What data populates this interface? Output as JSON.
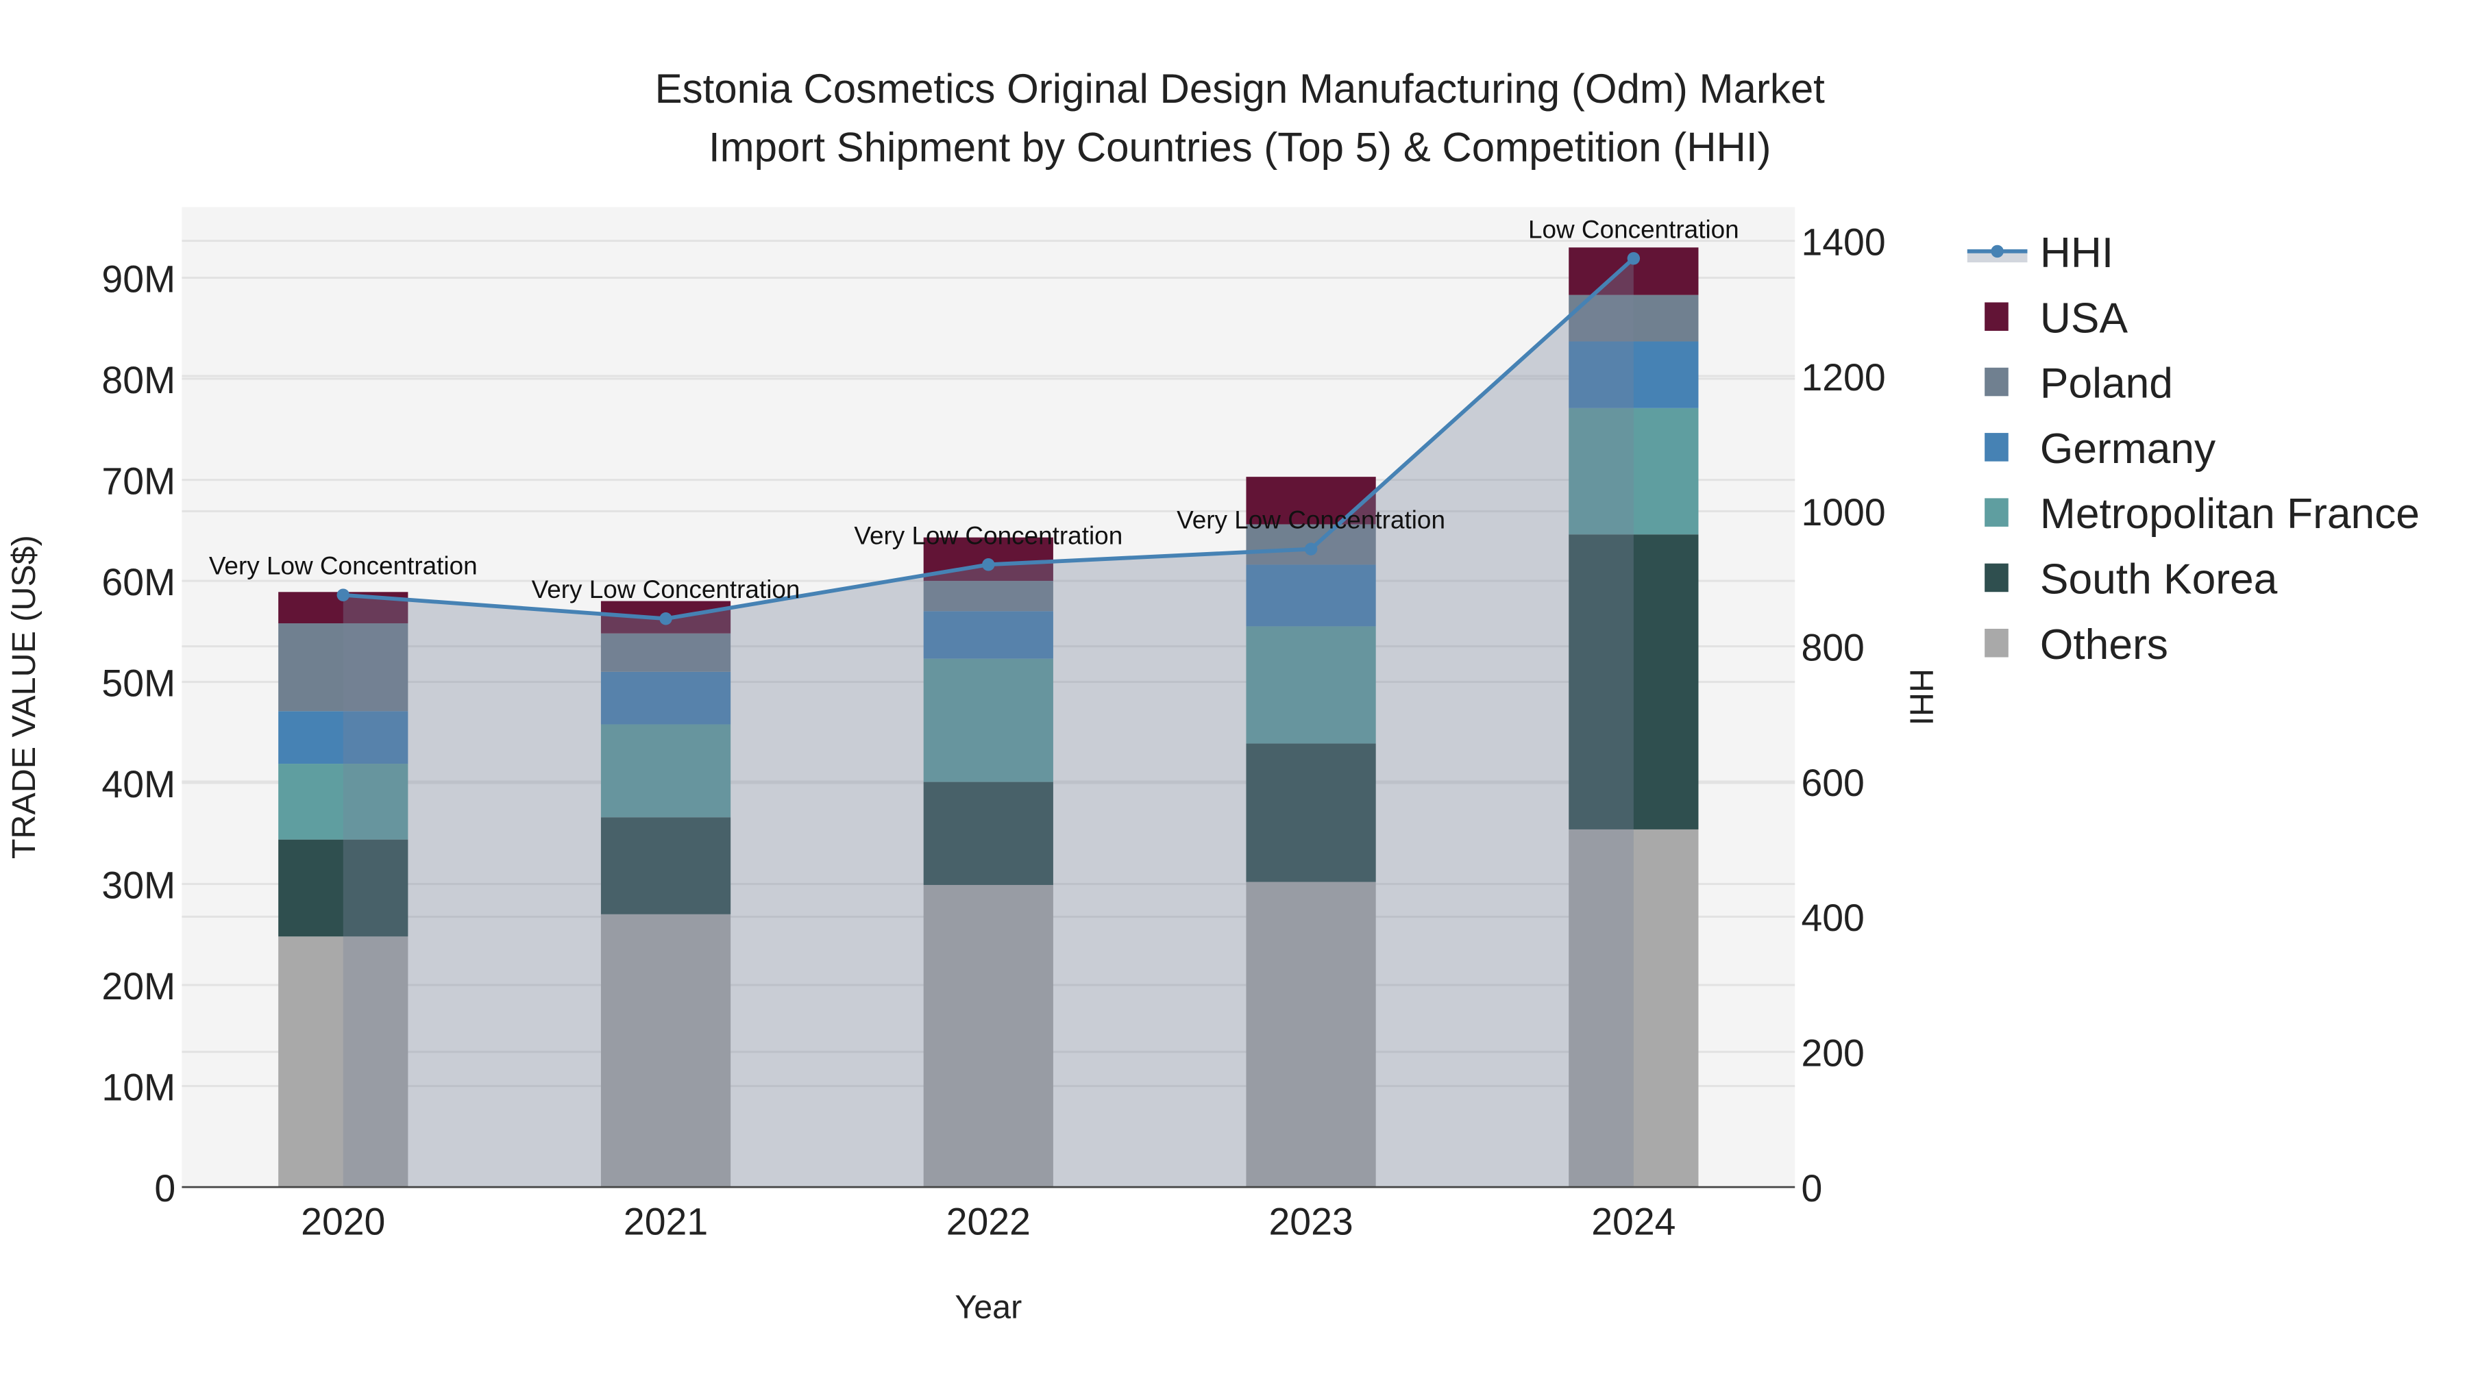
{
  "chart_data": {
    "type": "bar",
    "title_line1": "Estonia Cosmetics Original Design Manufacturing (Odm) Market",
    "title_line2": "Import Shipment by Countries (Top 5) & Competition (HHI)",
    "xlabel": "Year",
    "ylabel": "TRADE VALUE (US$)",
    "y2label": "HHI",
    "categories": [
      "2020",
      "2021",
      "2022",
      "2023",
      "2024"
    ],
    "ylim": [
      0,
      97000000
    ],
    "y2lim": [
      0,
      1450
    ],
    "yticks": [
      0,
      10000000,
      20000000,
      30000000,
      40000000,
      50000000,
      60000000,
      70000000,
      80000000,
      90000000
    ],
    "ytick_labels": [
      "0",
      "10M",
      "20M",
      "30M",
      "40M",
      "50M",
      "60M",
      "70M",
      "80M",
      "90M"
    ],
    "y2ticks": [
      0,
      200,
      400,
      600,
      800,
      1000,
      1200,
      1400
    ],
    "y2tick_labels": [
      "0",
      "200",
      "400",
      "600",
      "800",
      "1000",
      "1200",
      "1400"
    ],
    "barmode": "stack",
    "series": [
      {
        "name": "Others",
        "color": "#A9A9A9",
        "values": [
          24800000,
          27000000,
          29900000,
          30200000,
          35400000
        ]
      },
      {
        "name": "South Korea",
        "color": "#2F4F4F",
        "values": [
          9600000,
          9600000,
          10200000,
          13700000,
          29200000
        ]
      },
      {
        "name": "Metropolitan France",
        "color": "#5F9EA0",
        "values": [
          7500000,
          9200000,
          12200000,
          11600000,
          12500000
        ]
      },
      {
        "name": "Germany",
        "color": "#4682B4",
        "values": [
          5200000,
          5200000,
          4700000,
          6100000,
          6600000
        ]
      },
      {
        "name": "Poland",
        "color": "#708090",
        "values": [
          8700000,
          3800000,
          3000000,
          4000000,
          4600000
        ]
      },
      {
        "name": "USA",
        "color": "#621436",
        "values": [
          3100000,
          3200000,
          4300000,
          4700000,
          4700000
        ]
      }
    ],
    "hhi": {
      "name": "HHI",
      "color": "#4682B4",
      "values": [
        876,
        841,
        921,
        944,
        1374
      ],
      "annotations": [
        "Very Low Concentration",
        "Very Low Concentration",
        "Very Low Concentration",
        "Very Low Concentration",
        "Low Concentration"
      ]
    },
    "legend": [
      "HHI",
      "USA",
      "Poland",
      "Germany",
      "Metropolitan France",
      "South Korea",
      "Others"
    ],
    "legend_position": "right",
    "grid": true
  }
}
